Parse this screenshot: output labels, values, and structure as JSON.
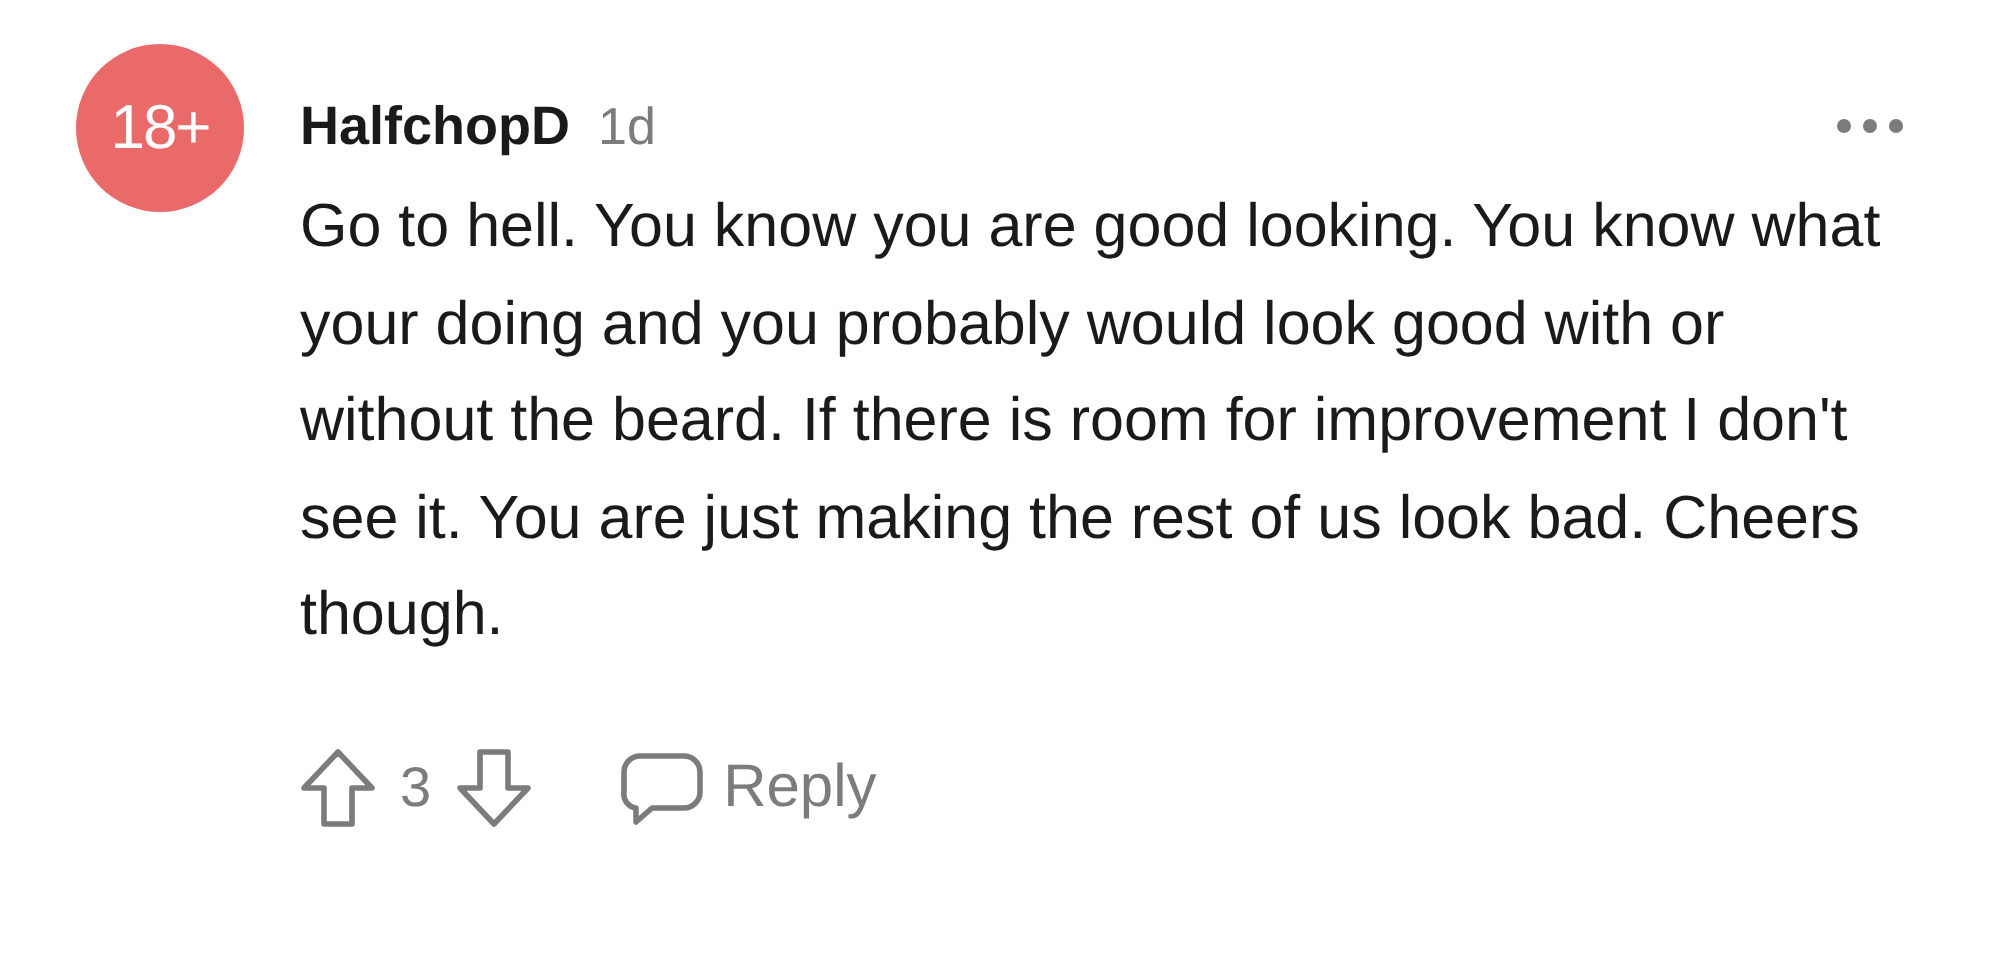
{
  "comment": {
    "avatar_text": "18+",
    "username": "HalfchopD",
    "age": "1d",
    "body": "Go to hell. You know you are good looking. You know what your doing and you probably would look good with or without the beard. If there is room for improvement I don't see it. You are just making the rest of us look bad. Cheers though.",
    "votes": "3",
    "reply": "Reply"
  }
}
